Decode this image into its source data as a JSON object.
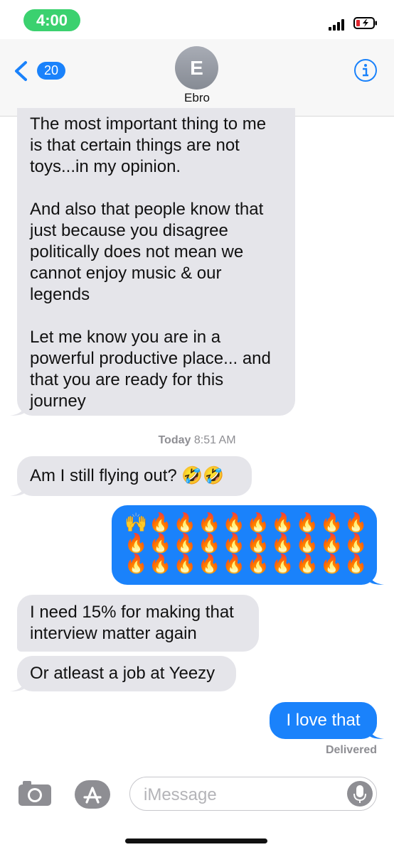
{
  "status_bar": {
    "time": "4:00"
  },
  "header": {
    "back_count": "20",
    "avatar_initial": "E",
    "contact_name": "Ebro"
  },
  "conversation": {
    "first_message": {
      "para1": "The most important thing to me is that certain things are not toys...in my opinion.",
      "para2": "And also that people know that just because you disagree politically does not mean we cannot enjoy music & our legends",
      "para3": "Let me know you are in a powerful productive place... and that you are ready for this journey"
    },
    "timestamp_day": "Today",
    "timestamp_time": "8:51 AM",
    "received_1": "Am I still flying out? 🤣🤣",
    "sent_emoji_row1": "🙌🔥🔥🔥🔥🔥🔥🔥🔥🔥",
    "sent_emoji_row2": "🔥🔥🔥🔥🔥🔥🔥🔥🔥🔥",
    "sent_emoji_row3": "🔥🔥🔥🔥🔥🔥🔥🔥🔥🔥",
    "received_2": "I need 15% for making that interview matter again",
    "received_3": "Or atleast a job at Yeezy",
    "sent_last": "I love that",
    "delivered": "Delivered"
  },
  "composer": {
    "placeholder": "iMessage"
  },
  "colors": {
    "blue": "#1a82fb",
    "gray_bubble": "#e5e5ea",
    "time_green": "#3bd16f"
  },
  "icons": [
    "chevron-left-icon",
    "info-icon",
    "camera-icon",
    "app-store-icon",
    "microphone-icon",
    "battery-icon",
    "signal-icon"
  ]
}
